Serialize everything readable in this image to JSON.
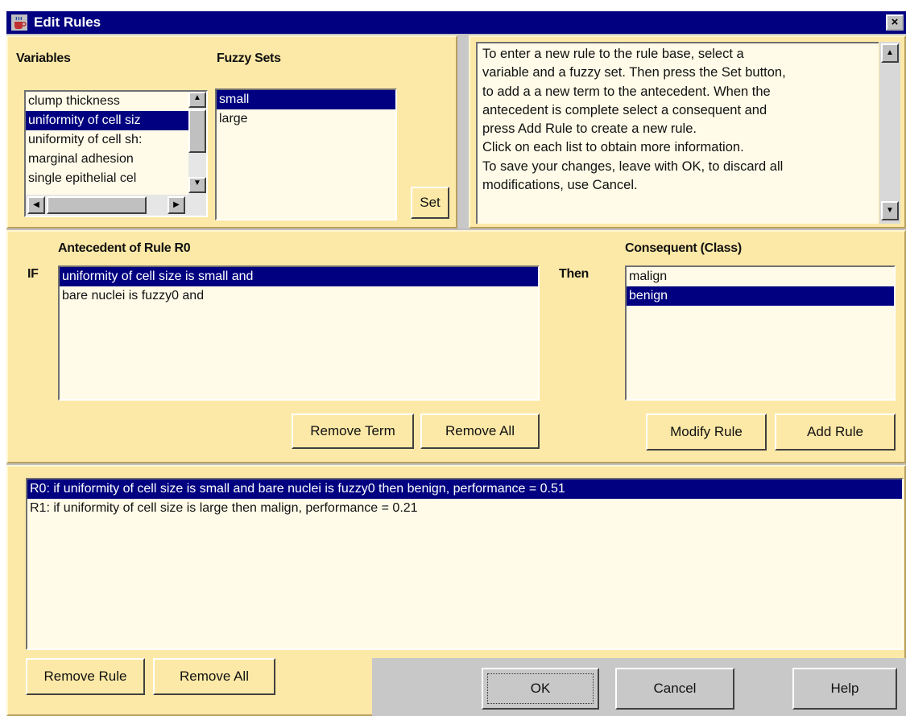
{
  "window": {
    "title": "Edit Rules",
    "close_glyph": "×",
    "icon": "coffee-cup-icon"
  },
  "variables": {
    "label": "Variables",
    "items": [
      "clump thickness",
      "uniformity of cell siz",
      "uniformity of cell sh:",
      "marginal adhesion",
      "single epithelial cel"
    ],
    "selected_index": 1
  },
  "fuzzy_sets": {
    "label": "Fuzzy Sets",
    "items": [
      "small",
      "large"
    ],
    "selected_index": 0,
    "set_button": "Set"
  },
  "help": {
    "lines": [
      "To enter a new rule to the rule base, select a",
      "variable and a fuzzy set. Then press the Set button,",
      "to add a a new term to the antecedent. When the",
      "antecedent is complete select a consequent and",
      "press Add Rule to create a new rule.",
      "Click on each list to obtain more information.",
      "To save your changes, leave with OK, to discard all",
      "modifications, use Cancel."
    ]
  },
  "antecedent": {
    "label": "Antecedent of Rule R0",
    "if_label": "IF",
    "terms": [
      "uniformity of cell size is small and",
      "bare nuclei is fuzzy0 and"
    ],
    "selected_index": 0,
    "remove_term_button": "Remove Term",
    "remove_all_button": "Remove All"
  },
  "consequent": {
    "label": "Consequent (Class)",
    "then_label": "Then",
    "classes": [
      "malign",
      "benign"
    ],
    "selected_index": 1,
    "modify_rule_button": "Modify Rule",
    "add_rule_button": "Add Rule"
  },
  "rule_base": {
    "rules": [
      "R0: if uniformity of cell size is small and bare nuclei is fuzzy0 then benign, performance = 0.51",
      "R1: if uniformity of cell size is large then malign, performance = 0.21"
    ],
    "selected_index": 0,
    "remove_rule_button": "Remove Rule",
    "remove_all_button": "Remove All"
  },
  "dialog_buttons": {
    "ok": "OK",
    "cancel": "Cancel",
    "help": "Help"
  },
  "colors": {
    "title_bar": "#000080",
    "panel": "#fde9a7",
    "list_bg": "#fffbe8",
    "selection": "#000080"
  }
}
